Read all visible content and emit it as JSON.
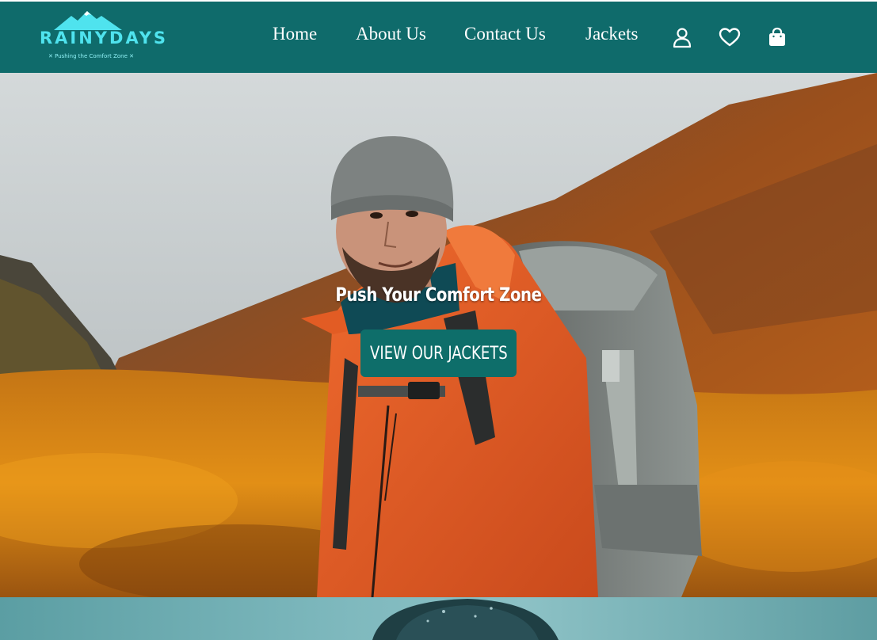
{
  "header": {
    "logo": {
      "wordmark": "RAINYDAYS",
      "tagline": "✕ Pushing the Comfort Zone ✕"
    },
    "nav": [
      {
        "label": "Home"
      },
      {
        "label": "About Us"
      },
      {
        "label": "Contact Us"
      },
      {
        "label": "Jackets"
      }
    ],
    "icons": [
      "user-icon",
      "heart-icon",
      "shopping-bag-icon"
    ]
  },
  "hero": {
    "title": "Push Your Comfort Zone",
    "cta_label": "VIEW OUR JACKETS"
  },
  "colors": {
    "brand_teal": "#0f6b6b",
    "logo_cyan": "#4fe3ee",
    "text_white": "#ffffff"
  }
}
